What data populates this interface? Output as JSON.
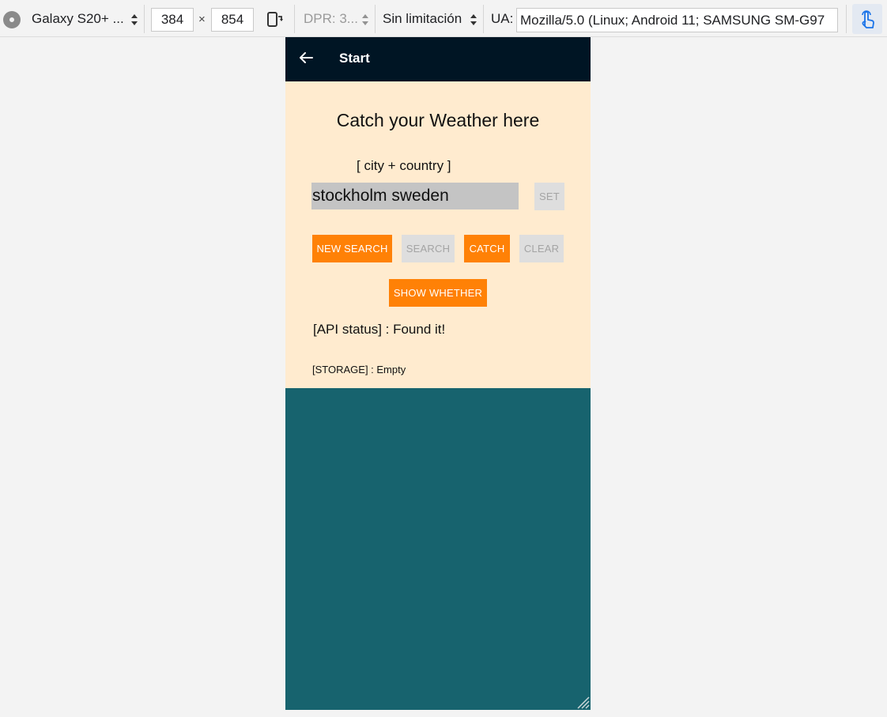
{
  "devtools": {
    "device": "Galaxy S20+ ...",
    "width": "384",
    "times": "×",
    "height": "854",
    "dpr": "DPR: 3...",
    "throttle": "Sin limitación",
    "ua_label": "UA:",
    "ua_value": "Mozilla/5.0 (Linux; Android 11; SAMSUNG SM-G97"
  },
  "app": {
    "title": "Start",
    "heading": "Catch your Weather here",
    "hint": "[ city + country ]",
    "city_value": "stockholm sweden",
    "buttons": {
      "set": "SET",
      "new_search": "NEW SEARCH",
      "search": "SEARCH",
      "catch": "CATCH",
      "clear": "CLEAR",
      "show": "SHOW WHETHER"
    },
    "status": "[API status] : Found it!",
    "storage": "[STORAGE] : Empty"
  },
  "colors": {
    "appbar": "#001524",
    "panel": "#ffebcf",
    "body": "#17636e",
    "accent": "#ff8106",
    "disabled": "#dedede"
  }
}
